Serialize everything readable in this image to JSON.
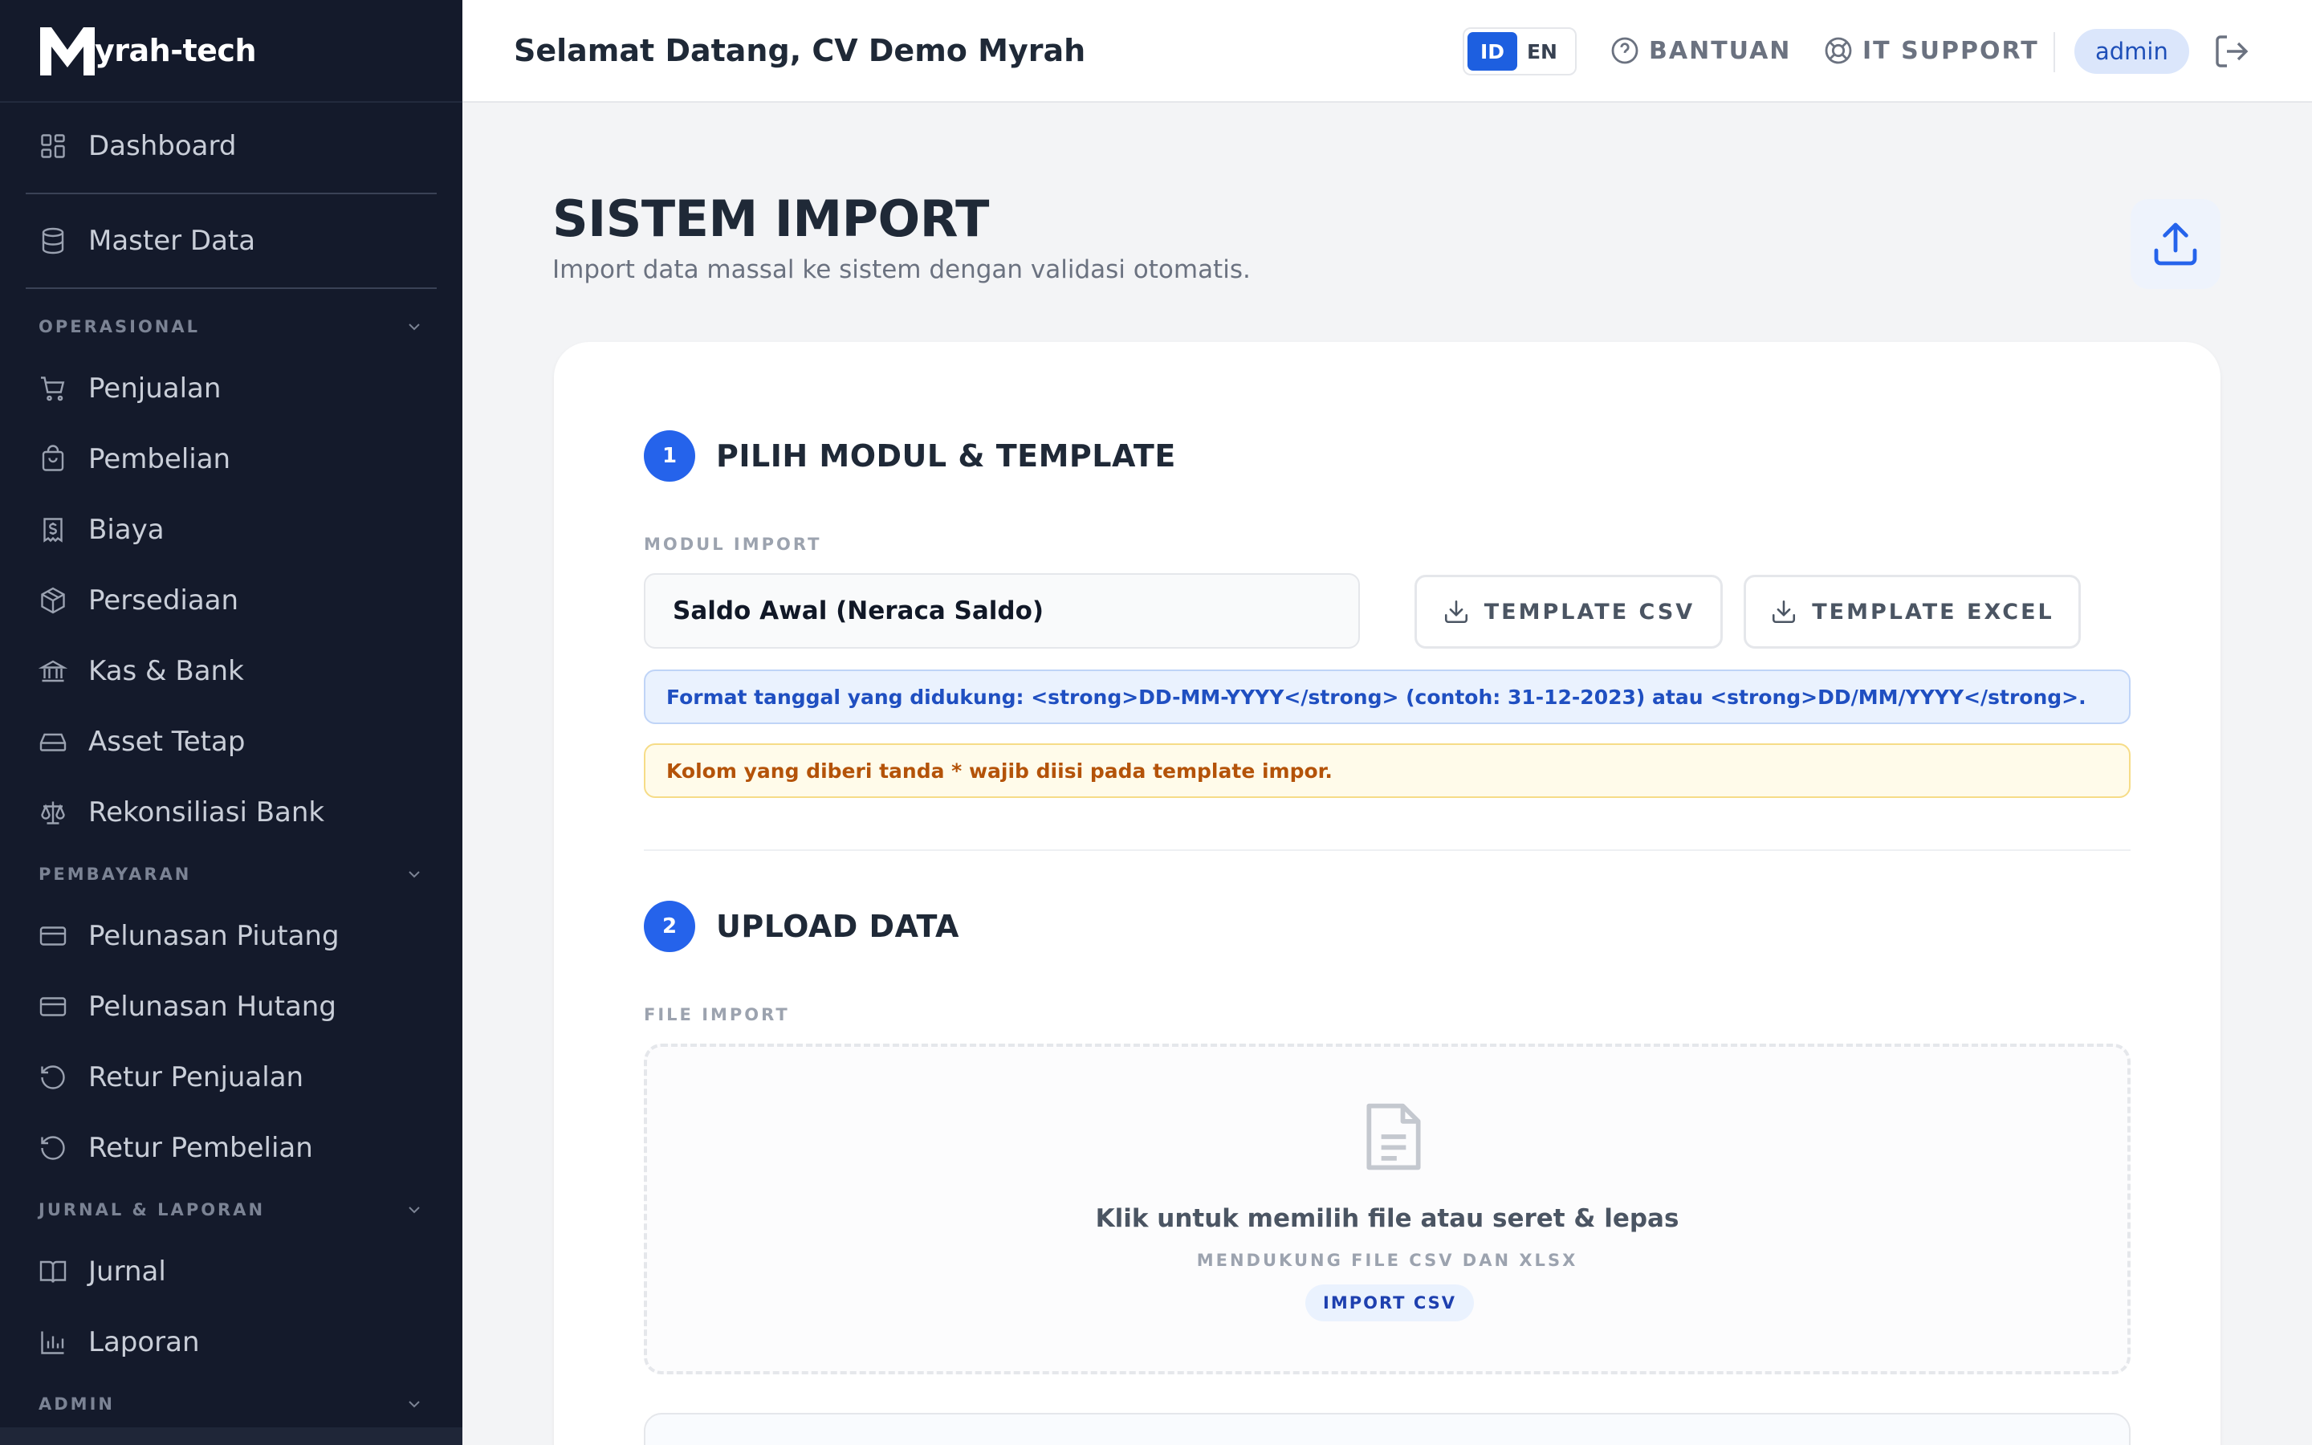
{
  "brand": {
    "name": "yrah-tech"
  },
  "sidebar": {
    "dashboard": "Dashboard",
    "master_data": "Master Data",
    "sections": [
      {
        "title": "OPERASIONAL",
        "items": [
          "Penjualan",
          "Pembelian",
          "Biaya",
          "Persediaan",
          "Kas & Bank",
          "Asset Tetap",
          "Rekonsiliasi Bank"
        ]
      },
      {
        "title": "PEMBAYARAN",
        "items": [
          "Pelunasan Piutang",
          "Pelunasan Hutang",
          "Retur Penjualan",
          "Retur Pembelian"
        ]
      },
      {
        "title": "JURNAL & LAPORAN",
        "items": [
          "Jurnal",
          "Laporan"
        ]
      },
      {
        "title": "ADMIN",
        "items": []
      }
    ]
  },
  "topbar": {
    "welcome": "Selamat Datang, CV Demo Myrah",
    "lang_options": [
      "ID",
      "EN"
    ],
    "lang_selected": "ID",
    "help": "BANTUAN",
    "support": "IT SUPPORT",
    "user": "admin"
  },
  "page": {
    "title": "SISTEM IMPORT",
    "subtitle": "Import data massal ke sistem dengan validasi otomatis."
  },
  "step1": {
    "number": "1",
    "title": "PILIH MODUL & TEMPLATE",
    "module_label": "MODUL IMPORT",
    "module_value": "Saldo Awal (Neraca Saldo)",
    "template_csv": "TEMPLATE CSV",
    "template_excel": "TEMPLATE EXCEL",
    "info_alert": "Format tanggal yang didukung: <strong>DD-MM-YYYY</strong> (contoh: 31-12-2023) atau <strong>DD/MM/YYYY</strong>.",
    "warning_alert": "Kolom yang diberi tanda * wajib diisi pada template impor."
  },
  "step2": {
    "number": "2",
    "title": "UPLOAD DATA",
    "file_label": "FILE IMPORT",
    "drop_title": "Klik untuk memilih file atau seret & lepas",
    "drop_sub": "MENDUKUNG FILE CSV DAN XLSX",
    "drop_tag": "IMPORT CSV"
  },
  "colors": {
    "sidebar_bg": "#141a2b",
    "accent": "#2563eb",
    "info_text": "#1f4fc1",
    "warn_text": "#b45309"
  }
}
